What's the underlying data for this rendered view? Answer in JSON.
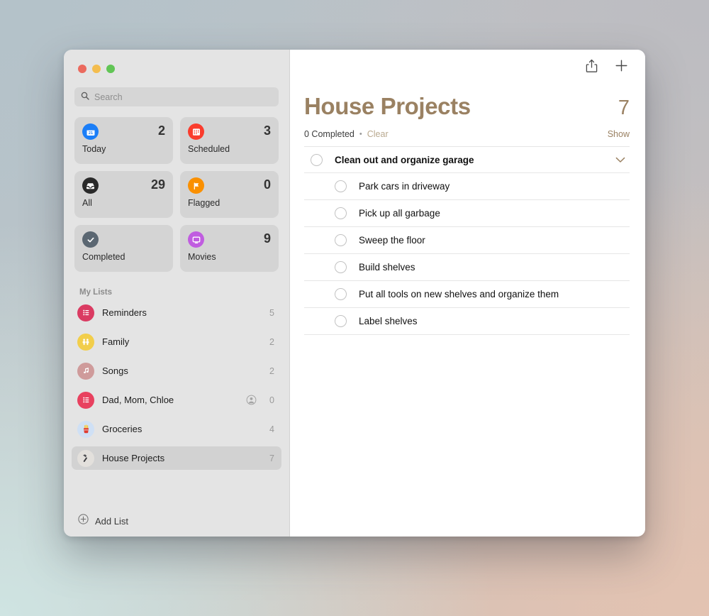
{
  "window": {
    "traffic_lights": [
      "close",
      "minimize",
      "zoom"
    ]
  },
  "theme": {
    "accent": "#9a8162",
    "sidebar_bg": "#e4e4e4",
    "card_bg": "#d4d4d4"
  },
  "sidebar": {
    "search": {
      "placeholder": "Search",
      "value": ""
    },
    "smart_lists": [
      {
        "label": "Today",
        "count": "2",
        "icon": "calendar-icon",
        "icon_color": "#1b7ef7",
        "day": "21"
      },
      {
        "label": "Scheduled",
        "count": "3",
        "icon": "calendar-clock-icon",
        "icon_color": "#fa3c2d"
      },
      {
        "label": "All",
        "count": "29",
        "icon": "inbox-icon",
        "icon_color": "#2a2a2a"
      },
      {
        "label": "Flagged",
        "count": "0",
        "icon": "flag-icon",
        "icon_color": "#fa9000"
      },
      {
        "label": "Completed",
        "count": "",
        "icon": "checkmark-icon",
        "icon_color": "#5b6772"
      },
      {
        "label": "Movies",
        "count": "9",
        "icon": "display-icon",
        "icon_color": "#c05de0"
      }
    ],
    "my_lists_header": "My Lists",
    "lists": [
      {
        "name": "Reminders",
        "count": "5",
        "icon": "list-lines-icon",
        "icon_color": "#da3b62",
        "shared": false,
        "selected": false
      },
      {
        "name": "Family",
        "count": "2",
        "icon": "people-icon",
        "icon_color": "#f2ce4b",
        "shared": false,
        "selected": false
      },
      {
        "name": "Songs",
        "count": "2",
        "icon": "music-note-icon",
        "icon_color": "#cf9b9b",
        "shared": false,
        "selected": false
      },
      {
        "name": "Dad, Mom, Chloe",
        "count": "0",
        "icon": "list-lines-icon",
        "icon_color": "#e8415f",
        "shared": true,
        "selected": false
      },
      {
        "name": "Groceries",
        "count": "4",
        "icon": "fries-emoji",
        "icon_color": "#cfe0f5",
        "emoji": "🍟",
        "shared": false,
        "selected": false
      },
      {
        "name": "House Projects",
        "count": "7",
        "icon": "hammer-emoji",
        "icon_color": "#e3e0dc",
        "emoji": "🔨",
        "shared": false,
        "selected": true
      }
    ],
    "add_list": {
      "label": "Add List",
      "icon": "plus-circle-icon"
    }
  },
  "main": {
    "toolbar": {
      "share": {
        "icon": "share-icon",
        "label": "Share"
      },
      "add": {
        "icon": "plus-icon",
        "label": "New Reminder"
      }
    },
    "title": "House Projects",
    "count": "7",
    "completed_text": "0 Completed",
    "separator": "•",
    "clear_label": "Clear",
    "show_label": "Show",
    "tasks": [
      {
        "text": "Clean out and organize garage",
        "level": "parent",
        "completed": false,
        "chevron": "chevron-down-icon"
      },
      {
        "text": "Park cars in driveway",
        "level": "child",
        "completed": false
      },
      {
        "text": "Pick up all garbage",
        "level": "child",
        "completed": false
      },
      {
        "text": "Sweep the floor",
        "level": "child",
        "completed": false
      },
      {
        "text": "Build shelves",
        "level": "child",
        "completed": false
      },
      {
        "text": "Put all tools on new shelves and organize them",
        "level": "child",
        "completed": false
      },
      {
        "text": "Label shelves",
        "level": "child",
        "completed": false
      }
    ]
  }
}
